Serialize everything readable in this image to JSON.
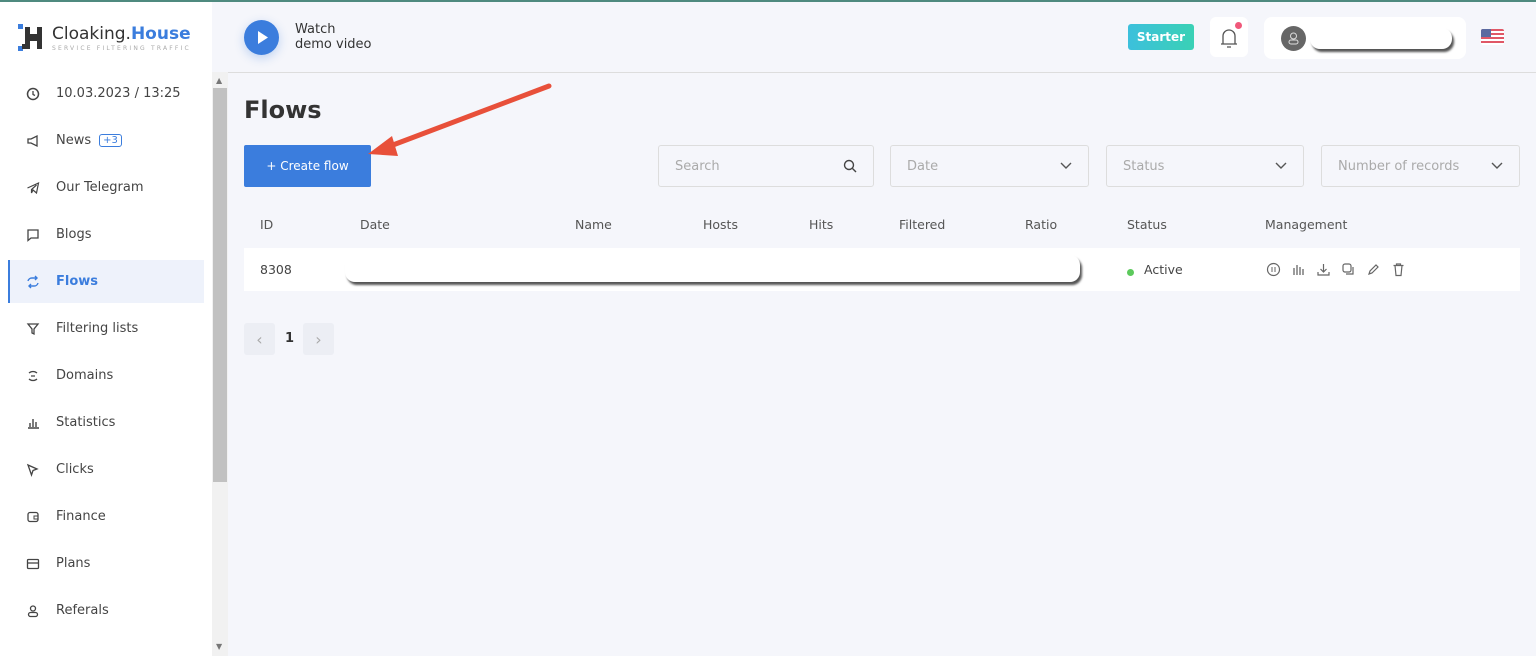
{
  "brand": {
    "name_part1": "Cloaking.",
    "name_part2": "House",
    "tagline": "SERVICE FILTERING TRAFFIC"
  },
  "sidebar": {
    "items": [
      {
        "label": "10.03.2023 / 13:25",
        "icon": "clock-icon"
      },
      {
        "label": "News",
        "icon": "megaphone-icon",
        "badge": "+3"
      },
      {
        "label": "Our Telegram",
        "icon": "telegram-icon"
      },
      {
        "label": "Blogs",
        "icon": "chat-icon"
      },
      {
        "label": "Flows",
        "icon": "repeat-icon",
        "active": true
      },
      {
        "label": "Filtering lists",
        "icon": "filter-icon"
      },
      {
        "label": "Domains",
        "icon": "domain-icon"
      },
      {
        "label": "Statistics",
        "icon": "bar-chart-icon"
      },
      {
        "label": "Clicks",
        "icon": "cursor-icon"
      },
      {
        "label": "Finance",
        "icon": "wallet-icon"
      },
      {
        "label": "Plans",
        "icon": "card-icon"
      },
      {
        "label": "Referals",
        "icon": "user-icon"
      }
    ]
  },
  "header": {
    "watch_line1": "Watch",
    "watch_line2": "demo video",
    "plan": "Starter",
    "language": "en-US"
  },
  "page": {
    "title": "Flows",
    "create_button": "+ Create flow"
  },
  "filters": {
    "search_placeholder": "Search",
    "date": "Date",
    "status": "Status",
    "records": "Number of records"
  },
  "table": {
    "columns": [
      "ID",
      "Date",
      "Name",
      "Hosts",
      "Hits",
      "Filtered",
      "Ratio",
      "Status",
      "Management"
    ],
    "rows": [
      {
        "id": "8308",
        "status": "Active"
      }
    ]
  },
  "pagination": {
    "current": "1"
  },
  "colors": {
    "accent": "#3b7ddd",
    "active_status": "#5cc95c",
    "annotation_arrow": "#e8503a"
  }
}
